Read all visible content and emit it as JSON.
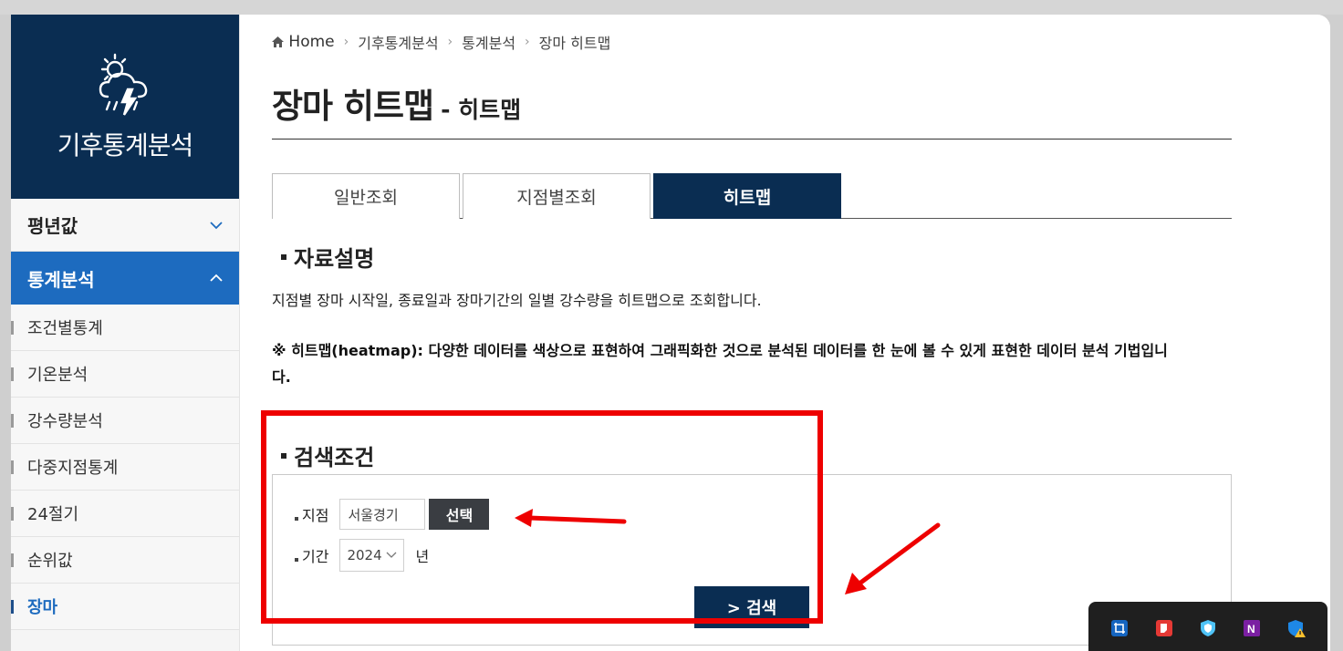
{
  "sidebar": {
    "title": "기후통계분석",
    "menu": [
      {
        "label": "평년값",
        "expanded": false
      },
      {
        "label": "통계분석",
        "expanded": true
      }
    ],
    "submenu": [
      "조건별통계",
      "기온분석",
      "강수량분석",
      "다중지점통계",
      "24절기",
      "순위값",
      "장마"
    ],
    "current": "장마"
  },
  "breadcrumb": [
    "Home",
    "기후통계분석",
    "통계분석",
    "장마 히트맵"
  ],
  "page": {
    "title": "장마 히트맵",
    "subtitle": "- 히트맵"
  },
  "tabs": [
    {
      "label": "일반조회",
      "active": false
    },
    {
      "label": "지점별조회",
      "active": false
    },
    {
      "label": "히트맵",
      "active": true
    }
  ],
  "section": {
    "title": "자료설명",
    "description": "지점별 장마 시작일, 종료일과 장마기간의 일별 강수량을 히트맵으로 조회합니다.",
    "note": "※ 히트맵(heatmap): 다양한 데이터를 색상으로 표현하여 그래픽화한 것으로 분석된 데이터를 한 눈에 볼 수 있게 표현한 데이터 분석 기법입니다."
  },
  "search": {
    "title": "검색조건",
    "station_label": "지점",
    "station_value": "서울경기",
    "select_button": "선택",
    "period_label": "기간",
    "year_value": "2024",
    "year_unit": "년",
    "submit_button": "> 검색"
  },
  "colors": {
    "navy": "#0a2d52",
    "accent_blue": "#1d6bbf",
    "highlight_red": "#ee0000"
  },
  "tray_icons": [
    "crop-icon",
    "pdf-app-icon",
    "shield-app-icon",
    "onenote-icon",
    "windows-security-warning-icon"
  ]
}
